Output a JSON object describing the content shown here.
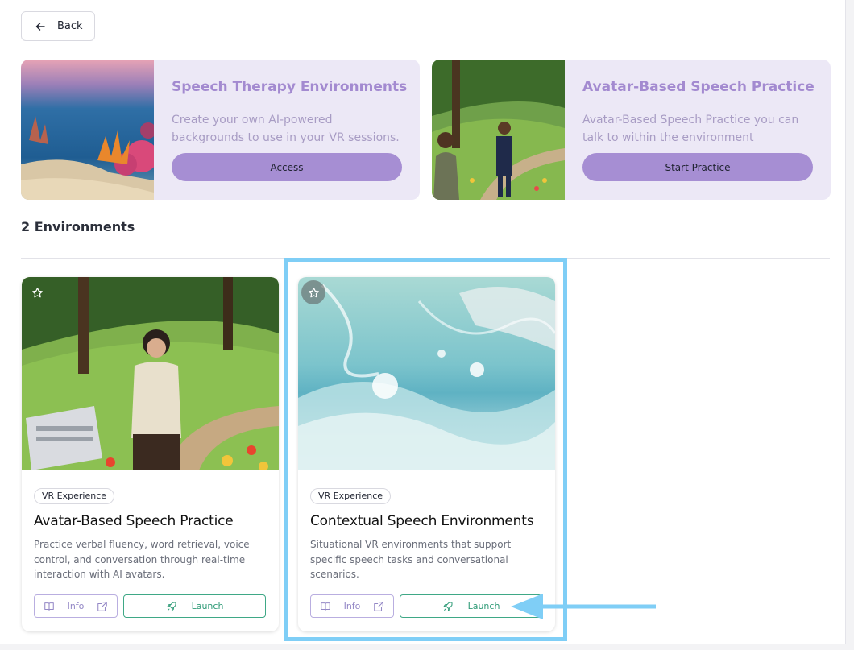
{
  "back_button": {
    "label": "Back"
  },
  "promos": [
    {
      "title": "Speech Therapy Environments",
      "description": "Create your own AI-powered backgrounds to use in your VR sessions.",
      "button_label": "Access"
    },
    {
      "title": "Avatar-Based Speech Practice",
      "description": "Avatar-Based Speech Practice you can talk to within the environment",
      "button_label": "Start Practice"
    }
  ],
  "environments_heading": "2 Environments",
  "cards": [
    {
      "badge": "VR Experience",
      "title": "Avatar-Based Speech Practice",
      "description": "Practice verbal fluency, word retrieval, voice control, and conversation through real-time interaction with AI avatars.",
      "info_label": "Info",
      "launch_label": "Launch"
    },
    {
      "badge": "VR Experience",
      "title": "Contextual Speech Environments",
      "description": "Situational VR environments that support specific speech tasks and conversational scenarios.",
      "info_label": "Info",
      "launch_label": "Launch"
    }
  ],
  "colors": {
    "promo_bg": "#ece8f6",
    "promo_title": "#a38ad0",
    "promo_button": "#a68ed3",
    "launch_accent": "#2f9b77",
    "info_accent": "#9488c6",
    "highlight": "#7fcef6"
  },
  "icons": {
    "back": "arrow-left-icon",
    "favorite": "star-icon",
    "info": "book-icon",
    "external": "external-link-icon",
    "launch": "rocket-icon"
  }
}
